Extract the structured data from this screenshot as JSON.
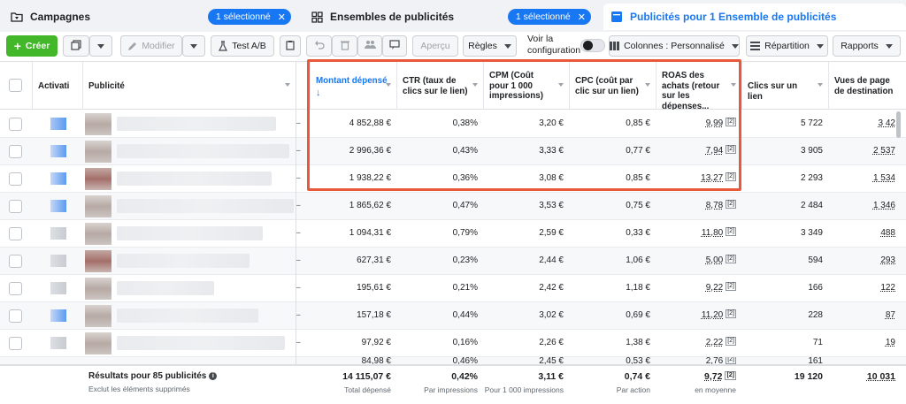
{
  "tabs": [
    {
      "title": "Campagnes",
      "badge": "1 sélectionné",
      "icon": "folder-icon"
    },
    {
      "title": "Ensembles de publicités",
      "badge": "1 sélectionné",
      "icon": "grid-icon"
    },
    {
      "title": "Publicités pour 1 Ensemble de publicités",
      "icon": "ad-page-icon"
    }
  ],
  "toolbar": {
    "create_label": "Créer",
    "modify_label": "Modifier",
    "ab_test_label": "Test A/B",
    "preview_label": "Aperçu",
    "rules_label": "Règles",
    "view_config_label": "Voir la configuration",
    "columns_label": "Colonnes : Personnalisé",
    "breakdown_label": "Répartition",
    "reports_label": "Rapports"
  },
  "columns": {
    "activation": "Activati",
    "ad": "Publicité",
    "amount_spent": "Montant dépensé",
    "ctr": "CTR (taux de clics sur le lien)",
    "cpm": "CPM (Coût pour 1 000 impressions)",
    "cpc": "CPC (coût par clic sur un lien)",
    "roas": "ROAS des achats (retour sur les dépenses...",
    "link_clicks": "Clics sur un lien",
    "landing_page_views": "Vues de page de destination"
  },
  "rows": [
    {
      "spent": "4 852,88 €",
      "ctr": "0,38%",
      "cpm": "3,20 €",
      "cpc": "0,85 €",
      "roas": "9,99",
      "roas_note": "[2]",
      "clicks": "5 722",
      "views": "3 42",
      "dash": "–"
    },
    {
      "spent": "2 996,36 €",
      "ctr": "0,43%",
      "cpm": "3,33 €",
      "cpc": "0,77 €",
      "roas": "7,94",
      "roas_note": "[2]",
      "clicks": "3 905",
      "views": "2 537",
      "dash": "–"
    },
    {
      "spent": "1 938,22 €",
      "ctr": "0,36%",
      "cpm": "3,08 €",
      "cpc": "0,85 €",
      "roas": "13,27",
      "roas_note": "[2]",
      "clicks": "2 293",
      "views": "1 534",
      "dash": "–"
    },
    {
      "spent": "1 865,62 €",
      "ctr": "0,47%",
      "cpm": "3,53 €",
      "cpc": "0,75 €",
      "roas": "8,78",
      "roas_note": "[2]",
      "clicks": "2 484",
      "views": "1 346",
      "dash": "–"
    },
    {
      "spent": "1 094,31 €",
      "ctr": "0,79%",
      "cpm": "2,59 €",
      "cpc": "0,33 €",
      "roas": "11,80",
      "roas_note": "[2]",
      "clicks": "3 349",
      "views": "488",
      "dash": "–"
    },
    {
      "spent": "627,31 €",
      "ctr": "0,23%",
      "cpm": "2,44 €",
      "cpc": "1,06 €",
      "roas": "5,00",
      "roas_note": "[2]",
      "clicks": "594",
      "views": "293",
      "dash": "–"
    },
    {
      "spent": "195,61 €",
      "ctr": "0,21%",
      "cpm": "2,42 €",
      "cpc": "1,18 €",
      "roas": "9,22",
      "roas_note": "[2]",
      "clicks": "166",
      "views": "122",
      "dash": "–"
    },
    {
      "spent": "157,18 €",
      "ctr": "0,44%",
      "cpm": "3,02 €",
      "cpc": "0,69 €",
      "roas": "11,20",
      "roas_note": "[2]",
      "clicks": "228",
      "views": "87",
      "dash": "–"
    },
    {
      "spent": "97,92 €",
      "ctr": "0,16%",
      "cpm": "2,26 €",
      "cpc": "1,38 €",
      "roas": "2,22",
      "roas_note": "[2]",
      "clicks": "71",
      "views": "19",
      "dash": "–"
    },
    {
      "spent": "84,98 €",
      "ctr": "0,46%",
      "cpm": "2,45 €",
      "cpc": "0,53 €",
      "roas": "2,76",
      "roas_note": "[2]",
      "clicks": "161",
      "views": "",
      "dash": "–"
    }
  ],
  "footer": {
    "results_label": "Résultats pour 85 publicités",
    "results_sub": "Exclut les éléments supprimés",
    "spent": "14 115,07 €",
    "spent_sub": "Total dépensé",
    "ctr": "0,42%",
    "ctr_sub": "Par impressions",
    "cpm": "3,11 €",
    "cpm_sub": "Pour 1 000 impressions",
    "cpc": "0,74 €",
    "cpc_sub": "Par action",
    "roas": "9,72",
    "roas_note": "[2]",
    "roas_sub": "en moyenne",
    "clicks": "19 120",
    "views": "10 031"
  },
  "colors": {
    "accent": "#1877f2",
    "create": "#42b72a",
    "highlight": "#e8583a"
  }
}
